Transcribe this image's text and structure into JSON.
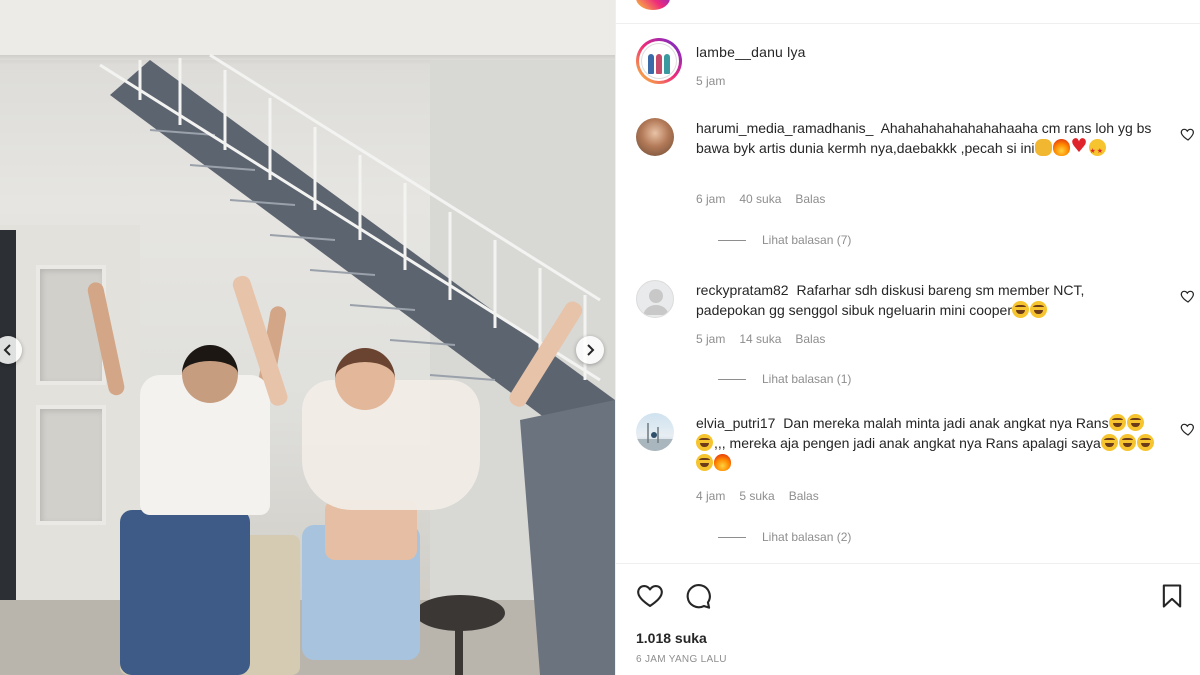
{
  "post": {
    "caption_user": "lambe__danu",
    "caption_text": "lya",
    "caption_time": "5 jam"
  },
  "comments": [
    {
      "user": "harumi_media_ramadhanis_",
      "text": "Ahahahahahahahahaaha cm rans loh yg bs bawa byk artis dunia kermh nya,daebakkk ,pecah si ini",
      "emojis": [
        "clap",
        "fire",
        "red-heart",
        "star-struck"
      ],
      "time": "6 jam",
      "likes": "40 suka",
      "reply_label": "Balas",
      "view_replies": "Lihat balasan (7)"
    },
    {
      "user": "reckypratam82",
      "text": "Rafarhar sdh diskusi bareng sm member NCT, padepokan gg senggol sibuk ngeluarin mini cooper",
      "emojis": [
        "laughing-tears",
        "laughing-tears"
      ],
      "time": "5 jam",
      "likes": "14 suka",
      "reply_label": "Balas",
      "view_replies": "Lihat balasan (1)"
    },
    {
      "user": "elvia_putri17",
      "text_a": "Dan mereka malah minta jadi anak angkat nya Rans",
      "emojis_a": [
        "laughing-tears",
        "laughing-tears",
        "laughing-tears"
      ],
      "text_b": ",,, mereka aja pengen jadi anak angkat nya Rans apalagi saya",
      "emojis_b": [
        "laughing-tears",
        "laughing-tears",
        "grinning",
        "grinning",
        "fire"
      ],
      "time": "4 jam",
      "likes": "5 suka",
      "reply_label": "Balas",
      "view_replies": "Lihat balasan (2)"
    }
  ],
  "footer": {
    "likes": "1.018 suka",
    "timestamp": "6 JAM YANG LALU"
  },
  "icons": {
    "like": "heart-outline-icon",
    "comment": "comment-bubble-icon",
    "save": "bookmark-icon",
    "carousel_prev": "chevron-left-icon",
    "carousel_next": "chevron-right-icon",
    "comment_like": "small-heart-icon"
  },
  "colors": {
    "text": "#262626",
    "muted": "#8e8e8e",
    "story_ring_start": "#f9ce34",
    "story_ring_mid": "#ee2a7b",
    "story_ring_end": "#6228d7"
  }
}
